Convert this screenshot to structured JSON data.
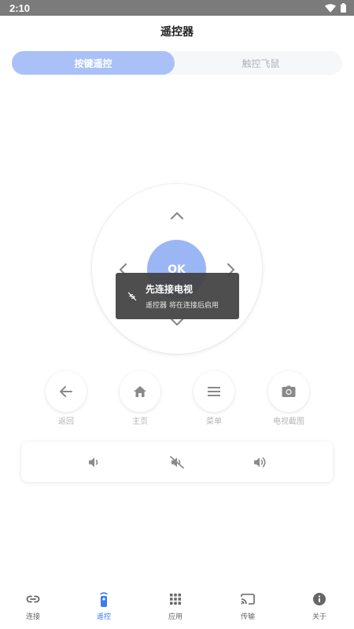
{
  "status_bar": {
    "time": "2:10"
  },
  "header": {
    "title": "遥控器"
  },
  "mode_tabs": [
    {
      "label": "按键遥控",
      "active": true
    },
    {
      "label": "触控飞鼠",
      "active": false
    }
  ],
  "dpad": {
    "ok_label": "OK"
  },
  "toast": {
    "title": "先连接电视",
    "subtitle": "遥控器 将在连接后启用",
    "icon": "link-off-icon"
  },
  "function_buttons": [
    {
      "label": "返回",
      "icon": "back-arrow-icon"
    },
    {
      "label": "主页",
      "icon": "home-icon"
    },
    {
      "label": "菜单",
      "icon": "menu-icon"
    },
    {
      "label": "电视截图",
      "icon": "camera-icon"
    }
  ],
  "volume_controls": [
    {
      "icon": "volume-down-icon"
    },
    {
      "icon": "volume-mute-icon"
    },
    {
      "icon": "volume-up-icon"
    }
  ],
  "bottom_nav": [
    {
      "label": "连接",
      "icon": "link-icon",
      "active": false
    },
    {
      "label": "遥控",
      "icon": "remote-icon",
      "active": true
    },
    {
      "label": "应用",
      "icon": "apps-grid-icon",
      "active": false
    },
    {
      "label": "传输",
      "icon": "cast-icon",
      "active": false
    },
    {
      "label": "关于",
      "icon": "info-icon",
      "active": false
    }
  ],
  "colors": {
    "accent": "#3a7bef",
    "tab_active": "#a9c1f6",
    "ok_button": "#9bb6f4",
    "status_bar": "#7b7b7b",
    "toast_bg": "#414141",
    "icon_gray": "#8a8a8a"
  }
}
